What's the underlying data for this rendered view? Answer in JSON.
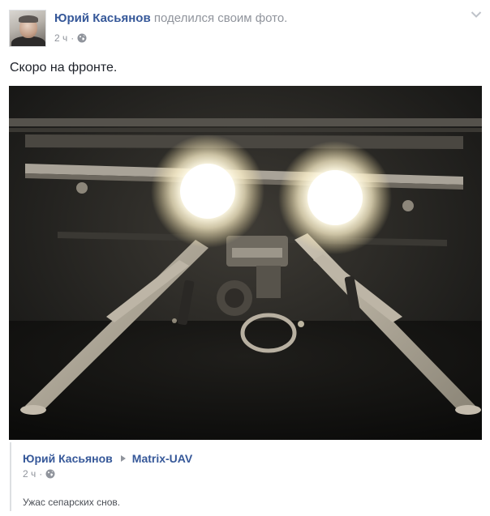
{
  "post": {
    "author_name": "Юрий Касьянов",
    "shared_text": "поделился своим фото.",
    "time": "2 ч",
    "dot": "·",
    "text": "Скоро на фронте."
  },
  "shared": {
    "author_name": "Юрий Касьянов",
    "page_name": "Matrix-UAV",
    "time": "2 ч",
    "dot": "·",
    "caption": "Ужас сепарских снов."
  },
  "icons": {
    "menu": "chevron-down-icon",
    "audience": "globe-icon",
    "share_arrow": "triangle-right-icon"
  },
  "colors": {
    "link": "#365899",
    "meta": "#90949c",
    "text": "#1d2129",
    "divider": "#dddfe2"
  }
}
